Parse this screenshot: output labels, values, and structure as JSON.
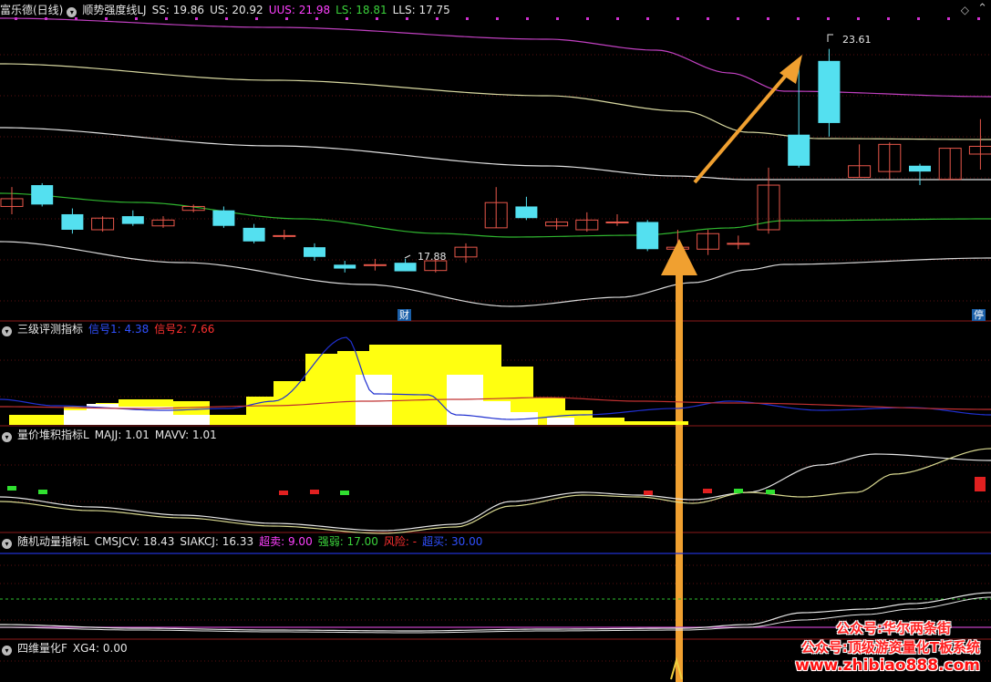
{
  "panel1": {
    "stock_name": "富乐德(日线)",
    "indicator": "顺势强度线LJ",
    "values": [
      {
        "label": "SS: 19.86",
        "color": "#e6e6e6"
      },
      {
        "label": "US: 20.92",
        "color": "#e6e6e6"
      },
      {
        "label": "UUS: 21.98",
        "color": "#ff40ff"
      },
      {
        "label": "LS: 18.81",
        "color": "#3bd23b"
      },
      {
        "label": "LLS: 17.75",
        "color": "#e6e6e6"
      }
    ],
    "high_label": "23.61",
    "low_label": "17.88",
    "tag_cai": "财",
    "tag_ting": "停",
    "corner_icon": "diamond-icon"
  },
  "panel2": {
    "name": "三级评测指标",
    "values": [
      {
        "label": "信号1: 4.38",
        "color": "#3050ff"
      },
      {
        "label": "信号2: 7.66",
        "color": "#ff3030"
      }
    ]
  },
  "panel3": {
    "name": "量价堆积指标L",
    "values": [
      {
        "label": "MAJJ: 1.01",
        "color": "#e6e6e6"
      },
      {
        "label": "MAVV: 1.01",
        "color": "#e6e6e6"
      }
    ]
  },
  "panel4": {
    "name": "随机动量指标L",
    "values": [
      {
        "label": "CMSJCV: 18.43",
        "color": "#e6e6e6"
      },
      {
        "label": "SIAKCJ: 16.33",
        "color": "#e6e6e6"
      },
      {
        "label": "超卖: 9.00",
        "color": "#ff40ff"
      },
      {
        "label": "强弱: 17.00",
        "color": "#3bd23b"
      },
      {
        "label": "风险: -",
        "color": "#ff3030"
      },
      {
        "label": "超买: 30.00",
        "color": "#3050ff"
      }
    ]
  },
  "panel5": {
    "name": "四维量化F",
    "values": [
      {
        "label": "XG4: 0.00",
        "color": "#e6e6e6"
      }
    ]
  },
  "watermark": {
    "line1": "公众号:华尔两条街",
    "line2": "公众号:顶级游资量化T板系统",
    "line3": "www.zhibiao888.com"
  },
  "chart_data": {
    "type": "candlestick",
    "title": "富乐德(日线)",
    "candles": [
      {
        "o": 19.55,
        "c": 19.75,
        "h": 20.05,
        "l": 19.35
      },
      {
        "o": 20.1,
        "c": 19.6,
        "h": 20.15,
        "l": 19.55
      },
      {
        "o": 19.35,
        "c": 18.95,
        "h": 19.5,
        "l": 18.85
      },
      {
        "o": 18.95,
        "c": 19.25,
        "h": 19.3,
        "l": 18.9
      },
      {
        "o": 19.3,
        "c": 19.1,
        "h": 19.45,
        "l": 19.05
      },
      {
        "o": 19.05,
        "c": 19.2,
        "h": 19.3,
        "l": 19.0
      },
      {
        "o": 19.45,
        "c": 19.55,
        "h": 19.6,
        "l": 19.4
      },
      {
        "o": 19.45,
        "c": 19.05,
        "h": 19.55,
        "l": 19.0
      },
      {
        "o": 19.0,
        "c": 18.65,
        "h": 19.1,
        "l": 18.6
      },
      {
        "o": 18.8,
        "c": 18.8,
        "h": 18.95,
        "l": 18.7
      },
      {
        "o": 18.5,
        "c": 18.25,
        "h": 18.6,
        "l": 18.15
      },
      {
        "o": 18.05,
        "c": 17.95,
        "h": 18.15,
        "l": 17.85
      },
      {
        "o": 18.05,
        "c": 18.05,
        "h": 18.2,
        "l": 17.9
      },
      {
        "o": 18.1,
        "c": 17.88,
        "h": 18.2,
        "l": 17.88
      },
      {
        "o": 17.9,
        "c": 18.15,
        "h": 18.2,
        "l": 17.85
      },
      {
        "o": 18.25,
        "c": 18.5,
        "h": 18.6,
        "l": 18.1
      },
      {
        "o": 19.0,
        "c": 19.65,
        "h": 20.05,
        "l": 19.0
      },
      {
        "o": 19.55,
        "c": 19.25,
        "h": 19.8,
        "l": 19.2
      },
      {
        "o": 19.05,
        "c": 19.15,
        "h": 19.25,
        "l": 18.95
      },
      {
        "o": 18.95,
        "c": 19.2,
        "h": 19.4,
        "l": 18.9
      },
      {
        "o": 19.15,
        "c": 19.15,
        "h": 19.35,
        "l": 19.05
      },
      {
        "o": 19.15,
        "c": 18.45,
        "h": 19.2,
        "l": 18.4
      },
      {
        "o": 18.45,
        "c": 18.5,
        "h": 18.95,
        "l": 18.35
      },
      {
        "o": 18.45,
        "c": 18.85,
        "h": 18.95,
        "l": 18.3
      },
      {
        "o": 18.6,
        "c": 18.6,
        "h": 18.8,
        "l": 18.45
      },
      {
        "o": 18.95,
        "c": 20.1,
        "h": 20.55,
        "l": 18.85
      },
      {
        "o": 21.4,
        "c": 20.6,
        "h": 23.2,
        "l": 20.55
      },
      {
        "o": 23.3,
        "c": 21.7,
        "h": 23.61,
        "l": 21.35
      },
      {
        "o": 20.3,
        "c": 20.6,
        "h": 21.15,
        "l": 20.3
      },
      {
        "o": 20.45,
        "c": 21.15,
        "h": 21.2,
        "l": 20.25
      },
      {
        "o": 20.6,
        "c": 20.45,
        "h": 20.65,
        "l": 20.1
      },
      {
        "o": 20.25,
        "c": 21.05,
        "h": 21.05,
        "l": 20.25
      },
      {
        "o": 20.9,
        "c": 21.1,
        "h": 21.8,
        "l": 20.5
      }
    ],
    "annotations": [
      "23.61",
      "17.88"
    ]
  }
}
